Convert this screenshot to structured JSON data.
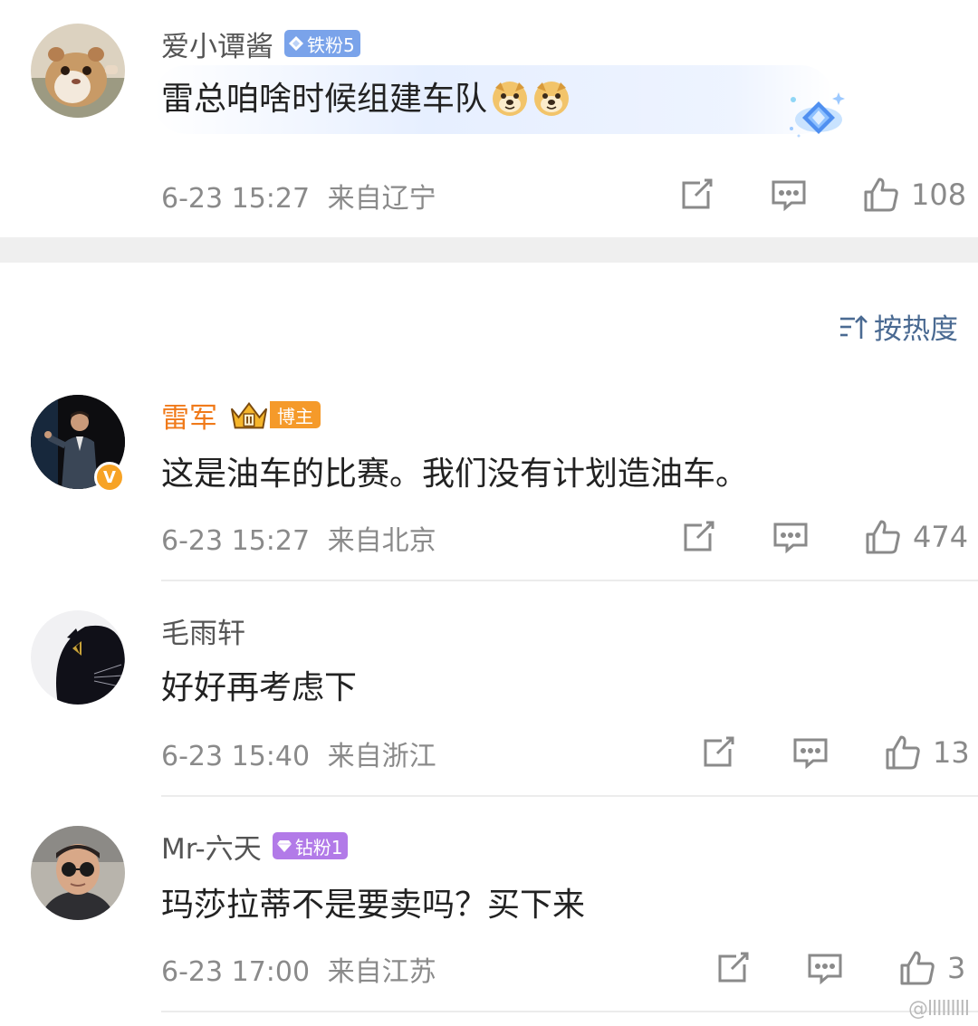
{
  "comments": [
    {
      "username": "爱小谭酱",
      "badge": "铁粉5",
      "text": "雷总咱啥时候组建车队",
      "emoji": [
        "doge-emoji",
        "doge-emoji"
      ],
      "time": "6-23 15:27",
      "location": "来自辽宁",
      "likes": "108"
    },
    {
      "username": "雷军",
      "badge": "博主",
      "verified": "V",
      "text": "这是油车的比赛。我们没有计划造油车。",
      "time": "6-23 15:27",
      "location": "来自北京",
      "likes": "474"
    },
    {
      "username": "毛雨轩",
      "text": "好好再考虑下",
      "time": "6-23 15:40",
      "location": "来自浙江",
      "likes": "13"
    },
    {
      "username": "Mr-六天",
      "badge": "钻粉1",
      "text": "玛莎拉蒂不是要卖吗？买下来",
      "time": "6-23 17:00",
      "location": "来自江苏",
      "likes": "3"
    }
  ],
  "sort_label": "按热度",
  "watermark": "@lllllllll",
  "colors": {
    "badge_iron": "#7aa3ea",
    "badge_blogger": "#f59a2a",
    "badge_diamond": "#b27ae8",
    "blogger_name": "#f07a1a",
    "sort_text": "#4a6a92"
  }
}
